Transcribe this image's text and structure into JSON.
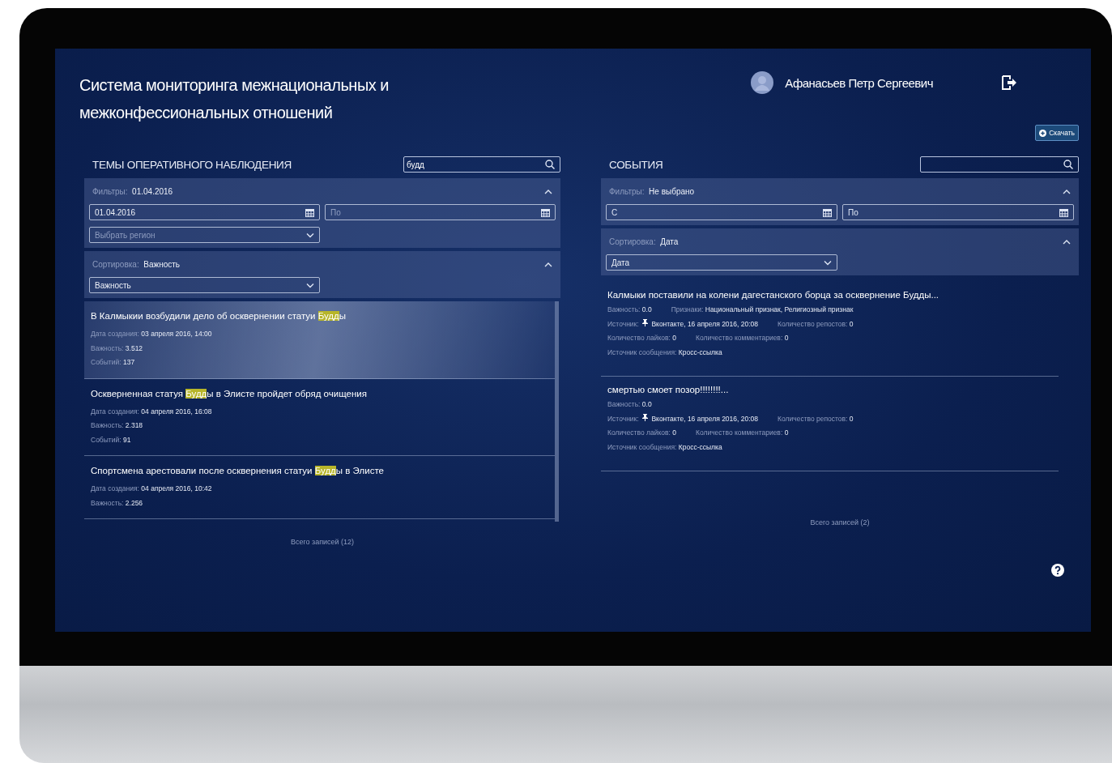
{
  "header": {
    "title": "Система мониторинга межнациональных и межконфессиональных отношений",
    "user_name": "Афанасьев Петр Сергеевич"
  },
  "download_button": {
    "label": "Скачать"
  },
  "panels": [
    {
      "kind": "topics",
      "heading": "ТЕМЫ ОПЕРАТИВНОГО НАБЛЮДЕНИЯ",
      "search": {
        "value": "будд"
      },
      "sections": [
        {
          "label": "Фильтры:",
          "value": "01.04.2016",
          "expanded": true,
          "controls": [
            {
              "kind": "date",
              "value": "01.04.2016"
            },
            {
              "kind": "date",
              "placeholder": "По"
            },
            {
              "kind": "select",
              "placeholder": "Выбрать регион"
            }
          ]
        },
        {
          "label": "Сортировка:",
          "value": "Важность",
          "expanded": true,
          "controls": [
            {
              "kind": "select",
              "value": "Важность"
            }
          ]
        }
      ],
      "items": [
        {
          "selected": true,
          "title_parts": [
            {
              "text": "В Калмыкии возбудили дело об осквернении статуи ",
              "highlighted": false
            },
            {
              "text": "Будд",
              "highlighted": true
            },
            {
              "text": "ы",
              "highlighted": false
            }
          ],
          "lines": [
            {
              "fields": [
                {
                  "kind": "plain",
                  "label": "Дата создания:",
                  "value": "03 апреля 2016, 14:00"
                }
              ]
            },
            {
              "fields": [
                {
                  "kind": "plain",
                  "label": "Важность:",
                  "value": "3.512"
                }
              ]
            },
            {
              "fields": [
                {
                  "kind": "plain",
                  "label": "Событий:",
                  "value": "137"
                }
              ]
            }
          ]
        },
        {
          "selected": false,
          "title_parts": [
            {
              "text": "Оскверненная статуя ",
              "highlighted": false
            },
            {
              "text": "Будд",
              "highlighted": true
            },
            {
              "text": "ы в Элисте пройдет обряд очищения",
              "highlighted": false
            }
          ],
          "lines": [
            {
              "fields": [
                {
                  "kind": "plain",
                  "label": "Дата создания:",
                  "value": "04 апреля 2016, 16:08"
                }
              ]
            },
            {
              "fields": [
                {
                  "kind": "plain",
                  "label": "Важность:",
                  "value": "2.318"
                }
              ]
            },
            {
              "fields": [
                {
                  "kind": "plain",
                  "label": "Событий:",
                  "value": "91"
                }
              ]
            }
          ]
        },
        {
          "selected": false,
          "title_parts": [
            {
              "text": "Спортсмена арестовали после осквернения статуи ",
              "highlighted": false
            },
            {
              "text": "Будд",
              "highlighted": true
            },
            {
              "text": "ы в Элисте",
              "highlighted": false
            }
          ],
          "lines": [
            {
              "fields": [
                {
                  "kind": "plain",
                  "label": "Дата создания:",
                  "value": "04 апреля 2016, 10:42"
                }
              ]
            },
            {
              "fields": [
                {
                  "kind": "plain",
                  "label": "Важность:",
                  "value": "2.256"
                }
              ]
            }
          ]
        }
      ],
      "total": "Всего записей (12)"
    },
    {
      "kind": "events",
      "heading": "СОБЫТИЯ",
      "sections": [
        {
          "label": "Фильтры:",
          "value": "Не выбрано",
          "expanded": true,
          "controls": [
            {
              "kind": "date",
              "placeholder": "С"
            },
            {
              "kind": "date",
              "placeholder": "По"
            }
          ]
        },
        {
          "label": "Сортировка:",
          "value": "Дата",
          "expanded": true,
          "controls": [
            {
              "kind": "select",
              "value": "Дата"
            }
          ]
        }
      ],
      "items": [
        {
          "selected": false,
          "title_parts": [
            {
              "text": "Калмыки поставили на колени дагестанского борца за осквернение Будды...",
              "highlighted": false
            }
          ],
          "lines": [
            {
              "fields": [
                {
                  "kind": "plain",
                  "label": "Важность:",
                  "value": "0.0"
                },
                {
                  "kind": "plain",
                  "label": "Признаки:",
                  "value": "Национальный признак, Религиозный признак"
                }
              ]
            },
            {
              "fields": [
                {
                  "kind": "source",
                  "label": "Источник:",
                  "value": "Вконтакте, 16 апреля 2016, 20:08"
                },
                {
                  "kind": "plain",
                  "label": "Количество репостов:",
                  "value": "0"
                }
              ]
            },
            {
              "fields": [
                {
                  "kind": "plain",
                  "label": "Количество лайков:",
                  "value": "0"
                },
                {
                  "kind": "plain",
                  "label": "Количество комментариев:",
                  "value": "0"
                }
              ]
            },
            {
              "fields": [
                {
                  "kind": "plain",
                  "label": "Источник сообщения:",
                  "value": "Кросс-ссылка"
                }
              ]
            }
          ]
        },
        {
          "selected": false,
          "title_parts": [
            {
              "text": "смертью смоет позор!!!!!!!!...",
              "highlighted": false
            }
          ],
          "lines": [
            {
              "fields": [
                {
                  "kind": "plain",
                  "label": "Важность:",
                  "value": "0.0"
                }
              ]
            },
            {
              "fields": [
                {
                  "kind": "source",
                  "label": "Источник:",
                  "value": "Вконтакте, 16 апреля 2016, 20:08"
                },
                {
                  "kind": "plain",
                  "label": "Количество репостов:",
                  "value": "0"
                }
              ]
            },
            {
              "fields": [
                {
                  "kind": "plain",
                  "label": "Количество лайков:",
                  "value": "0"
                },
                {
                  "kind": "plain",
                  "label": "Количество комментариев:",
                  "value": "0"
                }
              ]
            },
            {
              "fields": [
                {
                  "kind": "plain",
                  "label": "Источник сообщения:",
                  "value": "Кросс-ссылка"
                }
              ]
            }
          ]
        }
      ],
      "total": "Всего записей (2)"
    }
  ]
}
